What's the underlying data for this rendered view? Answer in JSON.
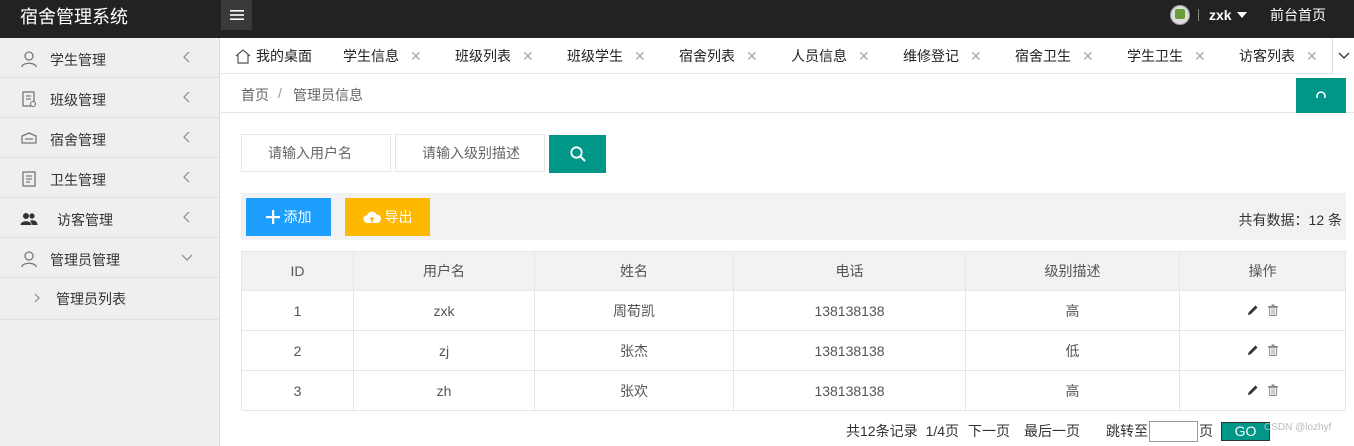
{
  "app": {
    "title": "宿舍管理系统"
  },
  "header": {
    "user_name": "zxk",
    "front_link": "前台首页"
  },
  "sidebar": {
    "items": [
      {
        "label": "学生管理"
      },
      {
        "label": "班级管理"
      },
      {
        "label": "宿舍管理"
      },
      {
        "label": "卫生管理"
      },
      {
        "label": "访客管理"
      },
      {
        "label": "管理员管理"
      }
    ],
    "sub_items": [
      {
        "label": "管理员列表"
      }
    ]
  },
  "tabs": [
    {
      "label": "我的桌面"
    },
    {
      "label": "学生信息"
    },
    {
      "label": "班级列表"
    },
    {
      "label": "班级学生"
    },
    {
      "label": "宿舍列表"
    },
    {
      "label": "人员信息"
    },
    {
      "label": "维修登记"
    },
    {
      "label": "宿舍卫生"
    },
    {
      "label": "学生卫生"
    },
    {
      "label": "访客列表"
    }
  ],
  "breadcrumb": {
    "home": "首页",
    "sep": "/",
    "current": "管理员信息"
  },
  "search": {
    "username_placeholder": "请输入用户名",
    "level_placeholder": "请输入级别描述"
  },
  "toolbar": {
    "add_label": "添加",
    "export_label": "导出",
    "total_text": "共有数据：12 条"
  },
  "table": {
    "headers": [
      "ID",
      "用户名",
      "姓名",
      "电话",
      "级别描述",
      "操作"
    ],
    "rows": [
      [
        "1",
        "zxk",
        "周荀凯",
        "138138138",
        "高"
      ],
      [
        "2",
        "zj",
        "张杰",
        "138138138",
        "低"
      ],
      [
        "3",
        "zh",
        "张欢",
        "138138138",
        "高"
      ]
    ]
  },
  "pager": {
    "records": "共12条记录",
    "pages": "1/4页",
    "next": "下一页",
    "last": "最后一页",
    "jump_to": "跳转至",
    "page_unit": "页",
    "go": "GO"
  },
  "watermark": "CSDN @lozhyf",
  "colors": {
    "header_bg": "#222222",
    "accent": "#009688",
    "add": "#1e9fff",
    "export": "#ffb800"
  }
}
